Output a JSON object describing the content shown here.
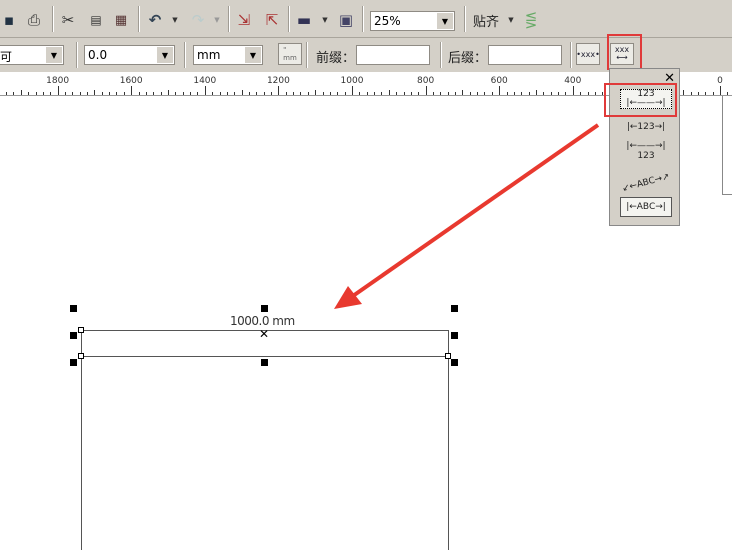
{
  "toolbar": {
    "icons": [
      "save-icon",
      "print-icon",
      "cut-icon",
      "copy-icon",
      "paste-icon",
      "undo-icon",
      "redo-icon",
      "import-icon",
      "export-icon",
      "application-launcher-icon",
      "view-manager-icon",
      "snap-settings-icon"
    ],
    "zoom_value": "25%",
    "snap_label": "贴齐"
  },
  "property_bar": {
    "style_value": "🔲",
    "precision_value": "0.0",
    "units_value": "mm",
    "show_units_label": "\"\nmm",
    "prefix_label": "前缀：",
    "prefix_value": "",
    "suffix_label": "后缀：",
    "suffix_value": "",
    "dynamic_dimension_label": "•xxx•",
    "text_position_label": "xxx"
  },
  "ruler": {
    "labels": [
      "1800",
      "1600",
      "1400",
      "1200",
      "1000",
      "800",
      "600",
      "400",
      "0"
    ]
  },
  "flyout": {
    "options": [
      "123",
      "123",
      "123",
      "ABC",
      "ABC"
    ],
    "selected_index": 0
  },
  "canvas": {
    "dimension_text": "1000.0 mm"
  },
  "colors": {
    "highlight": "#e03a3a",
    "arrow": "#e8392f",
    "toolbar": "#d4d0c8"
  }
}
